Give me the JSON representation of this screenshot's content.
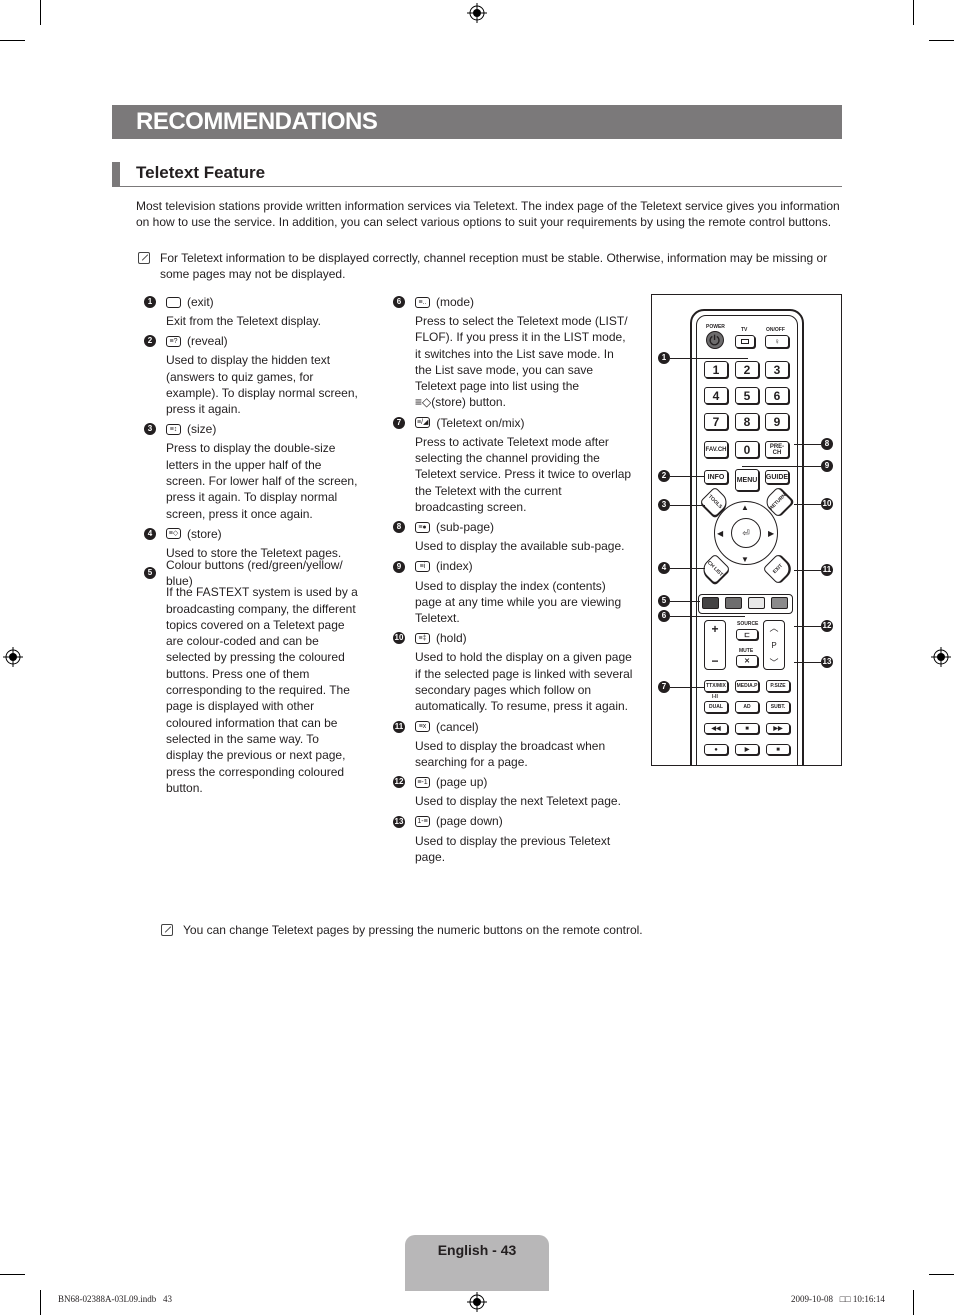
{
  "header": {
    "title": "RECOMMENDATIONS",
    "section": "Teletext Feature"
  },
  "intro": "Most television stations provide written information services via Teletext. The index page of the Teletext service gives you information on how to use the service. In addition, you can select various options to suit your requirements by using the remote control buttons.",
  "notes": [
    "For Teletext information to be displayed correctly, channel reception must be stable. Otherwise, information may be missing or some pages may not be displayed.",
    "You can change Teletext pages by pressing the numeric buttons on the remote control."
  ],
  "items_left": [
    {
      "num": "1",
      "icon": "exit-icon",
      "glyph": "",
      "title": "(exit)",
      "desc": "Exit from the Teletext display."
    },
    {
      "num": "2",
      "icon": "reveal-icon",
      "glyph": "≡?",
      "title": "(reveal)",
      "desc": "Used to display the hidden text (answers to quiz games, for example). To display normal screen, press it again."
    },
    {
      "num": "3",
      "icon": "size-icon",
      "glyph": "≡↕",
      "title": "(size)",
      "desc": "Press to display the double-size letters in the upper half of the screen. For lower half of the screen, press it again. To display normal screen, press it once again."
    },
    {
      "num": "4",
      "icon": "store-icon",
      "glyph": "≡◇",
      "title": "(store)",
      "desc": "Used to store the Teletext pages."
    },
    {
      "num": "5",
      "icon": "",
      "glyph": "",
      "title": "Colour buttons (red/green/yellow/ blue)",
      "desc": "If the FASTEXT system is used by a broadcasting company, the different topics covered on a Teletext page are colour-coded and can be selected by pressing the coloured buttons. Press one of them corresponding to the required. The page is displayed with other coloured information that can be selected in the same way. To display the previous or next page, press the corresponding coloured button."
    }
  ],
  "items_mid": [
    {
      "num": "6",
      "icon": "mode-icon",
      "glyph": "≡..",
      "title": "(mode)",
      "desc": "Press to select the Teletext mode (LIST/ FLOF). If you press it in the LIST mode, it switches into the List save mode. In the List save mode, you can save Teletext page into list using the ≡◇(store) button."
    },
    {
      "num": "7",
      "icon": "teletext-mix-icon",
      "glyph": "≡/◢",
      "title": "(Teletext on/mix)",
      "desc": "Press to activate Teletext mode after selecting the channel providing the Teletext service. Press it twice to overlap the Teletext with the current broadcasting screen."
    },
    {
      "num": "8",
      "icon": "sub-page-icon",
      "glyph": "≡●",
      "title": "(sub-page)",
      "desc": "Used to display the available sub-page."
    },
    {
      "num": "9",
      "icon": "index-icon",
      "glyph": "≡i",
      "title": "(index)",
      "desc": "Used to display the index (contents) page at any time while you are viewing Teletext."
    },
    {
      "num": "10",
      "icon": "hold-icon",
      "glyph": "≡‡",
      "title": "(hold)",
      "desc": "Used to hold the display on a given page if the selected page is linked with several secondary pages which follow on automatically. To resume, press it again."
    },
    {
      "num": "11",
      "icon": "cancel-icon",
      "glyph": "≡x",
      "title": "(cancel)",
      "desc": "Used to display the broadcast when searching for a page."
    },
    {
      "num": "12",
      "icon": "page-up-icon",
      "glyph": "≡-1",
      "title": "(page up)",
      "desc": "Used to display the next Teletext page."
    },
    {
      "num": "13",
      "icon": "page-down-icon",
      "glyph": "1-≡",
      "title": "(page down)",
      "desc": "Used to display the previous Teletext page."
    }
  ],
  "remote": {
    "power": "POWER",
    "tv": "TV",
    "onoff": "ON/OFF",
    "digits": [
      "1",
      "2",
      "3",
      "4",
      "5",
      "6",
      "7",
      "8",
      "9"
    ],
    "fav": "FAV.CH",
    "zero": "0",
    "prech": "PRE-CH",
    "info": "INFO",
    "menu": "MENU",
    "guide": "GUIDE",
    "tools": "TOOLS",
    "return": "RETURN",
    "chlist": "CH LIST",
    "exit": "EXIT",
    "source": "SOURCE",
    "mute": "MUTE",
    "p": "P",
    "ttx": "TTX/MIX",
    "media": "MEDIA.P",
    "psize": "P.SIZE",
    "dual_label": "I-II",
    "dual": "DUAL",
    "ad": "AD",
    "subt": "SUBT.",
    "colors": [
      "#444344",
      "#6e6d6e",
      "#e8e8e8",
      "#8b8a8b"
    ],
    "callouts": [
      "1",
      "2",
      "3",
      "4",
      "5",
      "6",
      "7",
      "8",
      "9",
      "10",
      "11",
      "12",
      "13"
    ]
  },
  "footer": {
    "page_label": "English - 43",
    "file": "BN68-02388A-03L09.indb   43",
    "timestamp": "2009-10-08   □□ 10:16:14"
  }
}
